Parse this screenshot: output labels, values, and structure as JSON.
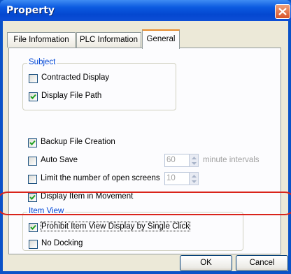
{
  "window": {
    "title": "Property"
  },
  "tabs": [
    {
      "label": "File Information"
    },
    {
      "label": "PLC Information"
    },
    {
      "label": "General"
    }
  ],
  "subject_group": {
    "label": "Subject",
    "contracted_display": {
      "label": "Contracted Display",
      "checked": false
    },
    "display_file_path": {
      "label": "Display File Path",
      "checked": true
    }
  },
  "options": {
    "backup_file_creation": {
      "label": "Backup File Creation",
      "checked": true
    },
    "auto_save": {
      "label": "Auto Save",
      "checked": false,
      "value": "60",
      "unit": "minute intervals"
    },
    "limit_open_screens": {
      "label": "Limit the number of open screens",
      "checked": false,
      "value": "10"
    },
    "display_item_in_movement": {
      "label": "Display Item in Movement",
      "checked": true
    }
  },
  "item_view_group": {
    "label": "Item View",
    "prohibit_single_click": {
      "label": "Prohibit Item View Display by Single Click",
      "checked": true
    },
    "no_docking": {
      "label": "No Docking",
      "checked": false
    }
  },
  "buttons": {
    "ok": "OK",
    "cancel": "Cancel"
  },
  "colors": {
    "title_bar": "#0b5ae0",
    "group_label": "#0046d5",
    "highlight": "#d9241b",
    "dialog_bg": "#ece9d8"
  }
}
